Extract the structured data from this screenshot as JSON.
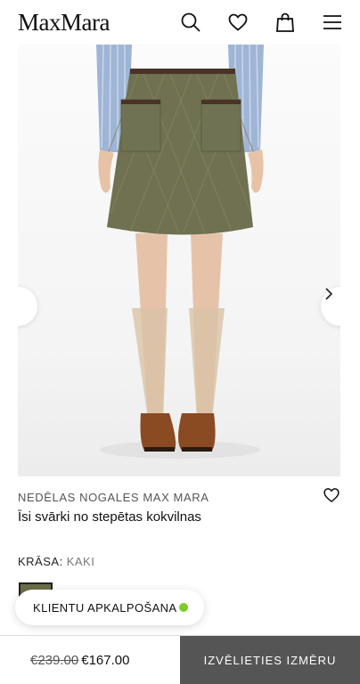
{
  "header": {
    "logo": "MaxMara",
    "icons": [
      "search-icon",
      "heart-icon",
      "shopping-bag-icon",
      "menu-icon"
    ]
  },
  "gallery": {
    "prev_icon": "chevron-left-icon",
    "next_icon": "chevron-right-icon"
  },
  "product": {
    "brand": "NEDĒLAS NOGALES MAX MARA",
    "title": "Īsi svārki no stepētas kokvilnas",
    "color_label": "KRĀSA:",
    "color_value": "KAKI",
    "swatch_color": "#6c6e4a"
  },
  "chat": {
    "label": "KLIENTU APKALPOŠANA",
    "status_color": "#7ccc2c"
  },
  "purchase": {
    "old_price": "€239.00",
    "price": "€167.00",
    "cta_label": "IZVĒLIETIES IZMĒRU"
  }
}
